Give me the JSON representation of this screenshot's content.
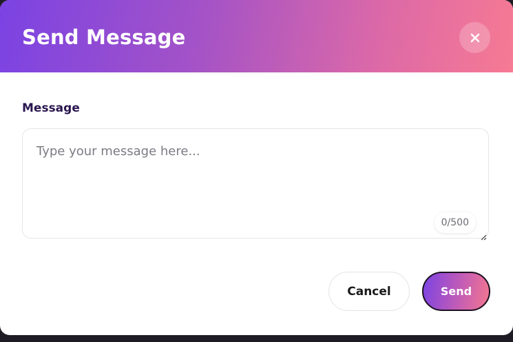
{
  "dialog": {
    "title": "Send Message",
    "close_icon": "close-icon"
  },
  "form": {
    "label": "Message",
    "placeholder": "Type your message here...",
    "value": "",
    "counter": "0/500"
  },
  "actions": {
    "cancel_label": "Cancel",
    "send_label": "Send"
  },
  "colors": {
    "gradient_start": "#7b43e3",
    "gradient_end": "#f67a93",
    "label_color": "#2a1650"
  }
}
